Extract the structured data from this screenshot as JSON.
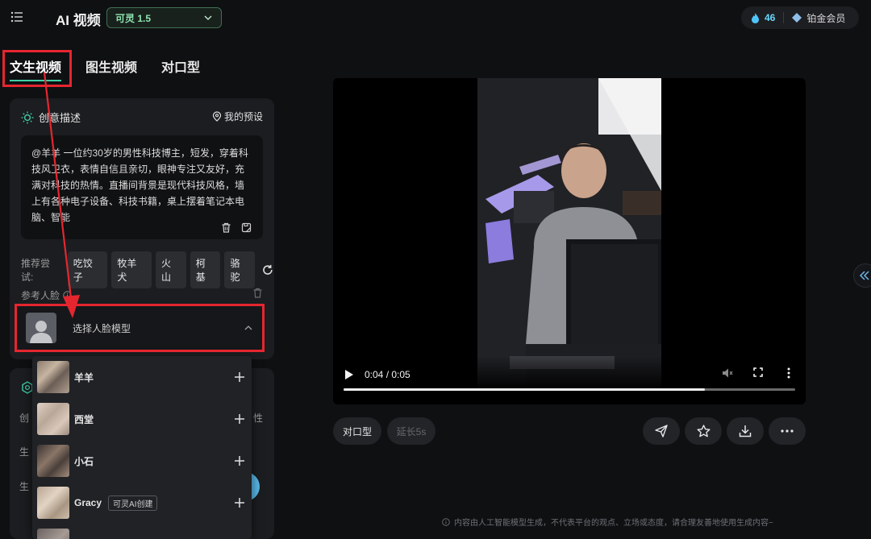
{
  "header": {
    "title": "AI 视频",
    "model_select": "可灵 1.5",
    "points": "46",
    "membership": "铂金会员"
  },
  "tabs": [
    {
      "label": "文生视频",
      "active": true
    },
    {
      "label": "图生视频",
      "active": false
    },
    {
      "label": "对口型",
      "active": false
    }
  ],
  "creative": {
    "heading": "创意描述",
    "preset_label": "我的预设",
    "prompt": "@羊羊 一位约30岁的男性科技博主，短发，穿着科技风卫衣，表情自信且亲切，眼神专注又友好，充满对科技的热情。直播间背景是现代科技风格，墙上有各种电子设备、科技书籍，桌上摆着笔记本电脑、智能",
    "suggest_label": "推荐尝试:",
    "suggestions": [
      "吃饺子",
      "牧羊犬",
      "火山",
      "柯基",
      "骆驼"
    ],
    "face_label": "参考人脸",
    "face_placeholder": "选择人脸模型"
  },
  "face_models": [
    {
      "name": "羊羊",
      "badge": ""
    },
    {
      "name": "西堂",
      "badge": ""
    },
    {
      "name": "小石",
      "badge": ""
    },
    {
      "name": "Gracy",
      "badge": "可灵AI创建"
    }
  ],
  "panel2": {
    "c1": "创",
    "c2": "性",
    "c3": "生",
    "c4": "生"
  },
  "player": {
    "time": "0:04 / 0:05",
    "progress": 0.8
  },
  "actions": {
    "lip_sync": "对口型",
    "extend": "延长5s"
  },
  "footer": {
    "disclaimer": "内容由人工智能模型生成，不代表平台的观点、立场或态度，请合理友善地使用生成内容~"
  },
  "colors": {
    "accent": "#3fd0a8",
    "annotation": "#e5262f",
    "points": "#66d9ff"
  }
}
